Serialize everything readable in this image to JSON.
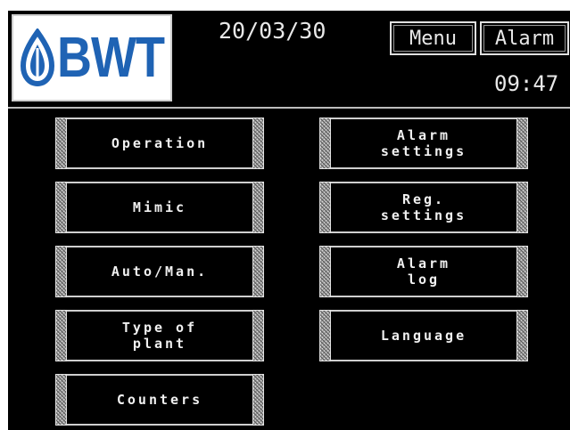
{
  "header": {
    "logo_text": "BWT",
    "date": "20/03/30",
    "time": "09:47",
    "menu_label": "Menu",
    "alarm_label": "Alarm"
  },
  "buttons": {
    "operation": "Operation",
    "mimic": "Mimic",
    "auto_man": "Auto/Man.",
    "type_of_plant": "Type of\nplant",
    "counters": "Counters",
    "alarm_settings": "Alarm\nsettings",
    "reg_settings": "Reg.\nsettings",
    "alarm_log": "Alarm\nlog",
    "language": "Language"
  },
  "colors": {
    "background": "#000000",
    "text": "#e8e8e8",
    "logo_blue": "#1f63b4"
  },
  "icons": {
    "logo_mark": "bwt-water-drop-icon"
  }
}
